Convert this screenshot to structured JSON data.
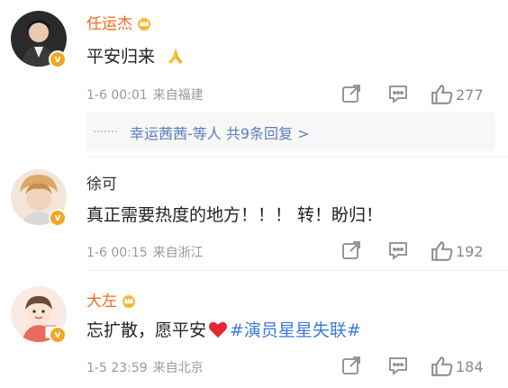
{
  "comments": [
    {
      "username": "任运杰",
      "has_crown": true,
      "content": "平安归来",
      "content_emoji": "pray-hands-emoji",
      "time": "1-6 00:01",
      "location": "来自福建",
      "likes": "277",
      "reply_names": "幸运茜茜-等人",
      "reply_count_text": "共9条回复 >"
    },
    {
      "username": "徐可",
      "has_crown": false,
      "content": "真正需要热度的地方！！！ 转！盼归！",
      "time": "1-6 00:15",
      "location": "来自浙江",
      "likes": "192"
    },
    {
      "username": "大左",
      "has_crown": true,
      "content": "忘扩散，愿平安",
      "content_emoji": "red-heart-emoji",
      "hashtag": "#演员星星失联#",
      "time": "1-5 23:59",
      "location": "来自北京",
      "likes": "184"
    }
  ],
  "colors": {
    "vip_name": "#f26b1d",
    "hashtag": "#3b7bd9",
    "reply_link": "#5a7fbf",
    "meta_text": "#999999",
    "verified_badge": "#f5a623"
  },
  "icons": [
    "share-icon",
    "comment-icon",
    "like-icon",
    "crown-icon",
    "verified-icon"
  ]
}
